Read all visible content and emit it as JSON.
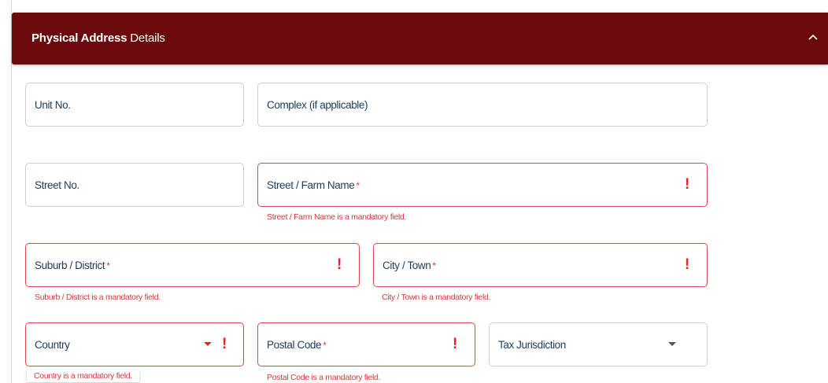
{
  "panel": {
    "title_bold": "Physical Address",
    "title_rest": " Details",
    "collapse_icon": "chevron-up-icon"
  },
  "fields": {
    "unit_no": {
      "label": "Unit No."
    },
    "complex": {
      "label": "Complex (if applicable)"
    },
    "street_no": {
      "label": "Street No."
    },
    "street_name": {
      "label": "Street / Farm Name",
      "required_mark": "*",
      "error": "Street / Farm Name is a mandatory field."
    },
    "suburb": {
      "label": "Suburb / District",
      "required_mark": "*",
      "error": "Suburb / District is a mandatory field."
    },
    "city": {
      "label": "City / Town",
      "required_mark": "*",
      "error": "City / Town is a mandatory field."
    },
    "country": {
      "label": "Country",
      "error": "Country is a mandatory field."
    },
    "postal_code": {
      "label": "Postal Code",
      "required_mark": "*",
      "error": "Postal Code is a mandatory field."
    },
    "tax_jurisdiction": {
      "label": "Tax Jurisdiction"
    }
  },
  "icons": {
    "error": "exclamation-icon",
    "dropdown": "caret-down-icon"
  },
  "colors": {
    "header_bg": "#6b0a0c",
    "error": "#e0484a",
    "label": "#1d3d5c"
  }
}
